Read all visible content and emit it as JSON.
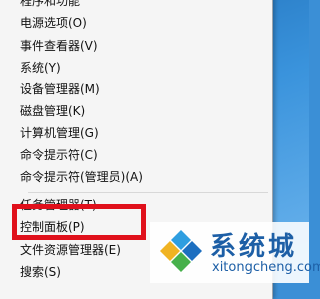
{
  "context_menu": {
    "items": [
      {
        "label": "程序和功能"
      },
      {
        "label": "电源选项(O)"
      },
      {
        "label": "事件查看器(V)"
      },
      {
        "label": "系统(Y)"
      },
      {
        "label": "设备管理器(M)"
      },
      {
        "label": "磁盘管理(K)"
      },
      {
        "label": "计算机管理(G)"
      },
      {
        "label": "命令提示符(C)"
      },
      {
        "label": "命令提示符(管理员)(A)"
      },
      {
        "label": "任务管理器(T)"
      },
      {
        "label": "控制面板(P)"
      },
      {
        "label": "文件资源管理器(E)"
      },
      {
        "label": "搜索(S)"
      }
    ],
    "highlighted_item": "控制面板(P)"
  },
  "watermark": {
    "brand": "系统城",
    "url": "xitongcheng.com",
    "icon": "diamond-logo-icon"
  },
  "colors": {
    "highlight_border": "#e0101b",
    "brand_blue": "#1d5fa6"
  }
}
